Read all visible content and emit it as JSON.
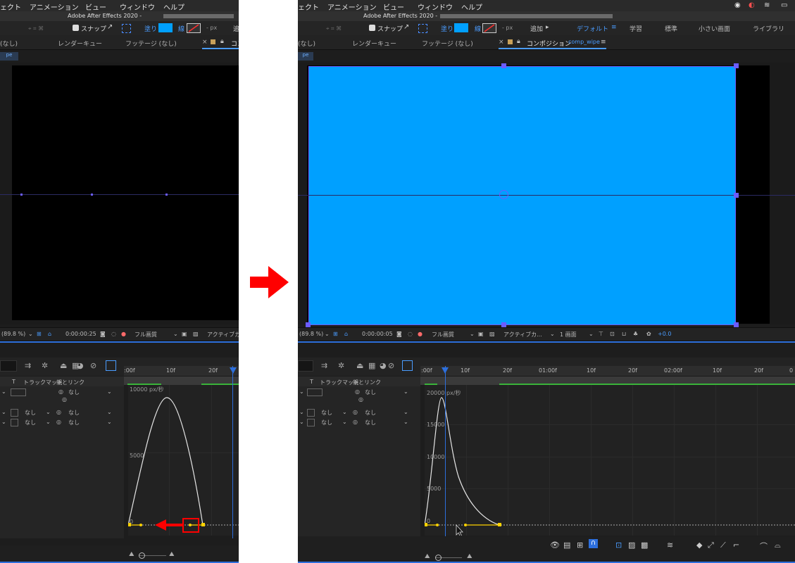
{
  "colors": {
    "fill": "#00a0ff",
    "arrow": "#ff0000",
    "playhead": "#2d6fdc",
    "keyframe": "#ffd200",
    "selection": "#6b5cff"
  },
  "left": {
    "menu": [
      "ェクト",
      "アニメーション",
      "ビュー",
      "ウィンドウ",
      "ヘルプ"
    ],
    "title": "Adobe After Effects 2020 -",
    "toolbar": {
      "snap": "スナップ",
      "fill": "塗り",
      "stroke": "線",
      "px": "- px",
      "add": "追"
    },
    "tabs": [
      "(なし)",
      "レンダーキュー",
      "フッテージ (なし)",
      "×",
      "コン"
    ],
    "comp_tab": "pe",
    "viewer_toolbar": {
      "zoom": "(89.8 %)",
      "timecode": "0:00:00:25",
      "quality": "フル画質",
      "view": "アクティブカ"
    },
    "ruler": [
      ":00f",
      "10f",
      "20f"
    ],
    "graph_labels": [
      "10000 px/秒",
      "5000",
      "0"
    ],
    "columns": {
      "t": "T",
      "trackmatte": "トラックマット",
      "parent": "親とリンク"
    },
    "rows": [
      {
        "mode": "",
        "parent": "なし"
      },
      {
        "mode": "なし",
        "parent": "なし"
      },
      {
        "mode": "なし",
        "parent": "なし"
      }
    ]
  },
  "arrow_label": "",
  "right": {
    "menu": [
      "ェクト",
      "アニメーション",
      "ビュー",
      "ウィンドウ",
      "ヘルプ"
    ],
    "title": "Adobe After Effects 2020 -",
    "toolbar": {
      "snap": "スナップ",
      "fill": "塗り",
      "stroke": "線",
      "px": "- px",
      "add": "追加",
      "workspaces": [
        "デフォルト",
        "学習",
        "標準",
        "小さい画面",
        "ライブラリ"
      ]
    },
    "tabs": [
      "(なし)",
      "レンダーキュー",
      "フッテージ (なし)",
      "×",
      "コンポジション"
    ],
    "comp_name": "comp_wipe",
    "comp_tab": "pe",
    "viewer_toolbar": {
      "zoom": "(89.8 %)",
      "timecode": "0:00:00:05",
      "quality": "フル画質",
      "view": "アクティブカ...",
      "screens": "1 画面",
      "exposure": "+0.0"
    },
    "ruler": [
      ":00f",
      "10f",
      "20f",
      "01:00f",
      "10f",
      "20f",
      "02:00f",
      "10f",
      "20f",
      "0"
    ],
    "graph_labels": [
      "20000 px/秒",
      "15000",
      "10000",
      "5000",
      "0"
    ],
    "columns": {
      "t": "T",
      "trackmatte": "トラックマット",
      "parent": "親とリンク"
    },
    "rows": [
      {
        "mode": "",
        "parent": "なし"
      },
      {
        "mode": "なし",
        "parent": "なし"
      },
      {
        "mode": "なし",
        "parent": "なし"
      }
    ]
  }
}
